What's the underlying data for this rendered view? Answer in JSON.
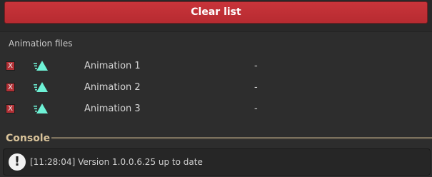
{
  "toolbar": {
    "clear_label": "Clear list"
  },
  "animation_files": {
    "title": "Animation files",
    "items": [
      {
        "remove_label": "X",
        "icon": "animation-clip-icon",
        "name": "Animation 1",
        "status": "-"
      },
      {
        "remove_label": "X",
        "icon": "animation-clip-icon",
        "name": "Animation 2",
        "status": "-"
      },
      {
        "remove_label": "X",
        "icon": "animation-clip-icon",
        "name": "Animation 3",
        "status": "-"
      }
    ]
  },
  "console": {
    "title": "Console",
    "message": "[11:28:04] Version 1.0.0.6.25 up to date",
    "icon": "info-icon",
    "icon_glyph": "!"
  },
  "colors": {
    "accent_red": "#c8343a",
    "icon_teal": "#6ef2d6",
    "console_title": "#d9c39a"
  }
}
